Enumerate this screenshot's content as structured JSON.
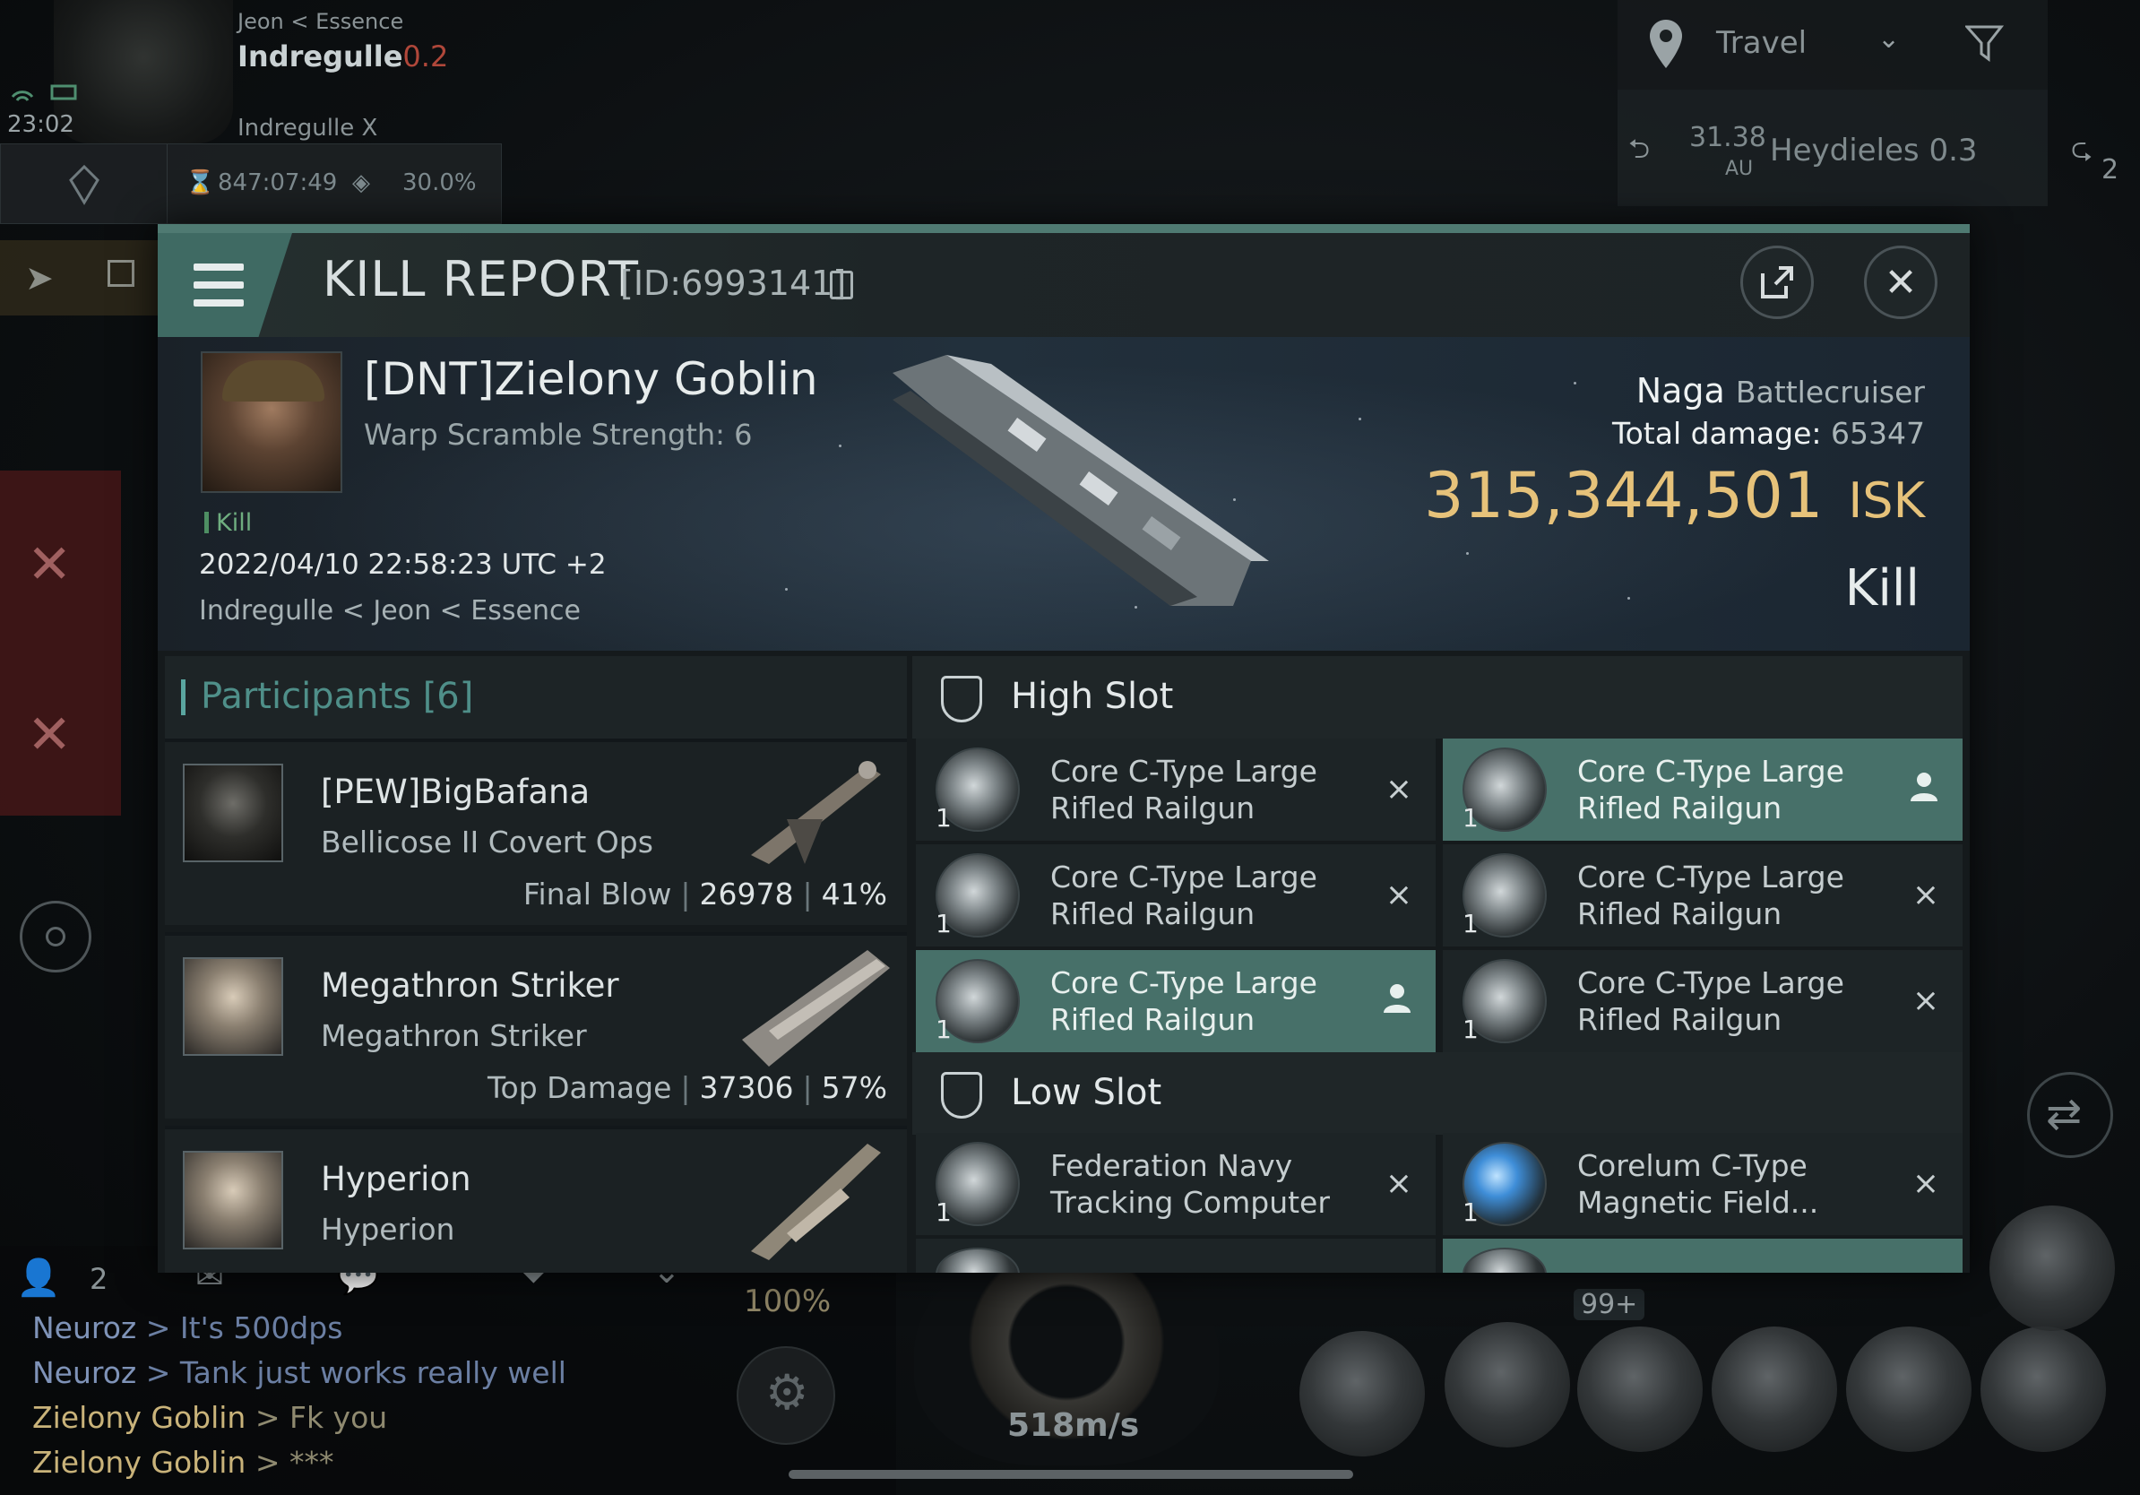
{
  "hud": {
    "char_alliance_line": "Jeon < Essence",
    "system_name": "Indregulle",
    "system_sec": "0.2",
    "time": "23:02",
    "current_system_label": "Indregulle X",
    "timer": "847:07:49",
    "cargo": "30.0%",
    "travel_label": "Travel",
    "route_distance": "31.38",
    "route_unit": "AU",
    "route_dest": "Heydieles 0.3",
    "route_count": "2",
    "local_count": "2",
    "capacitor": "100%",
    "speed": "518m/s",
    "badge": "99+"
  },
  "chat": [
    {
      "name": "Neuroz",
      "msg": "> It's 500dps",
      "style": "blue"
    },
    {
      "name": "Neuroz",
      "msg": "> Tank just works really well",
      "style": "blue"
    },
    {
      "name": "Zielony Goblin",
      "msg": "> Fk you",
      "style": "gold"
    },
    {
      "name": "Zielony Goblin",
      "msg": "> ***",
      "style": "gold"
    }
  ],
  "modal": {
    "title": "KILL REPORT",
    "report_id": "[ID:6993141]",
    "victim": {
      "name": "[DNT]Zielony Goblin",
      "sub": "Warp Scramble Strength: 6",
      "tag": "Kill",
      "datetime": "2022/04/10 22:58:23 UTC +2",
      "location": "Indregulle < Jeon < Essence"
    },
    "ship": {
      "name": "Naga",
      "class": "Battlecruiser",
      "total_damage_label": "Total damage:",
      "total_damage": "65347",
      "isk_value": "315,344,501",
      "isk_unit": "ISK",
      "result": "Kill"
    },
    "participants": {
      "label": "Participants",
      "count": "[6]",
      "items": [
        {
          "name": "[PEW]BigBafana",
          "ship": "Bellicose II Covert Ops",
          "stat_label": "Final Blow",
          "damage": "26978",
          "percent": "41%"
        },
        {
          "name": "Megathron Striker",
          "ship": "Megathron Striker",
          "stat_label": "Top Damage",
          "damage": "37306",
          "percent": "57%"
        },
        {
          "name": "Hyperion",
          "ship": "Hyperion",
          "stat_label": "",
          "damage": "",
          "percent": ""
        }
      ]
    },
    "high_slot": {
      "label": "High Slot",
      "items": [
        {
          "name": "Core C-Type Large Rifled Railgun",
          "qty": "1",
          "status": "destroyed"
        },
        {
          "name": "Core C-Type Large Rifled Railgun",
          "qty": "1",
          "status": "dropped"
        },
        {
          "name": "Core C-Type Large Rifled Railgun",
          "qty": "1",
          "status": "destroyed"
        },
        {
          "name": "Core C-Type Large Rifled Railgun",
          "qty": "1",
          "status": "destroyed"
        },
        {
          "name": "Core C-Type Large Rifled Railgun",
          "qty": "1",
          "status": "dropped"
        },
        {
          "name": "Core C-Type Large Rifled Railgun",
          "qty": "1",
          "status": "destroyed"
        }
      ]
    },
    "low_slot": {
      "label": "Low Slot",
      "items": [
        {
          "name": "Federation Navy Tracking Computer",
          "qty": "1",
          "status": "destroyed"
        },
        {
          "name": "Corelum C-Type Magnetic Field...",
          "qty": "1",
          "status": "destroyed"
        }
      ]
    },
    "icons": {
      "destroyed": "×",
      "dropped": "person-icon"
    }
  }
}
